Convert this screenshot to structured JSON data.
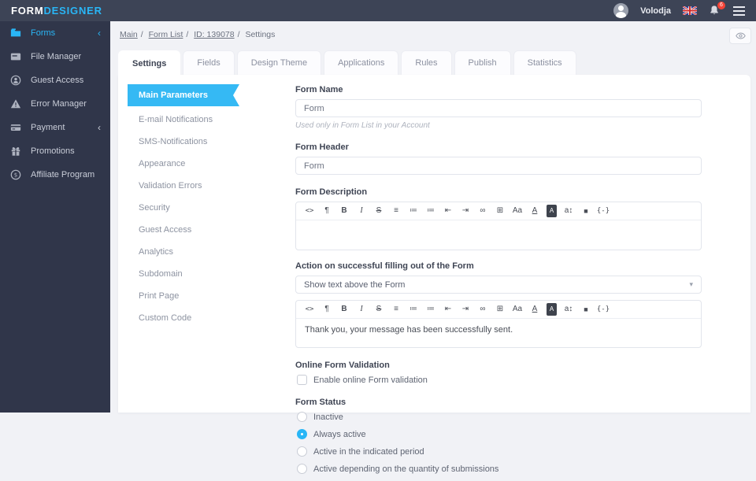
{
  "colors": {
    "accent": "#29b6f6",
    "header_bg": "#3d4456",
    "sidebar_bg": "#30364a",
    "page_bg": "#f1f2f6",
    "badge_red": "#f44336",
    "active_subnav": "#35b9f4"
  },
  "header": {
    "logo_primary": "FORM",
    "logo_accent": "DESIGNER",
    "username": "Volodja",
    "notification_count": "6"
  },
  "sidebar": {
    "chevron": "‹",
    "items": [
      {
        "label": "Forms",
        "icon": "forms-icon"
      },
      {
        "label": "File Manager",
        "icon": "file-manager-icon"
      },
      {
        "label": "Guest Access",
        "icon": "guest-access-icon"
      },
      {
        "label": "Error Manager",
        "icon": "error-manager-icon"
      },
      {
        "label": "Payment",
        "icon": "payment-icon"
      },
      {
        "label": "Promotions",
        "icon": "promotions-icon"
      },
      {
        "label": "Affiliate Program",
        "icon": "affiliate-icon"
      }
    ]
  },
  "breadcrumb": {
    "separator": "/",
    "items": [
      {
        "label": "Main"
      },
      {
        "label": "Form List"
      },
      {
        "label": "ID: 139078"
      },
      {
        "label": "Settings"
      }
    ]
  },
  "tabs": {
    "active": "Settings",
    "items": [
      {
        "label": "Settings"
      },
      {
        "label": "Fields"
      },
      {
        "label": "Design Theme"
      },
      {
        "label": "Applications"
      },
      {
        "label": "Rules"
      },
      {
        "label": "Publish"
      },
      {
        "label": "Statistics"
      }
    ]
  },
  "subnav": {
    "active": "Main Parameters",
    "items": [
      {
        "label": "Main Parameters"
      },
      {
        "label": "E-mail Notifications"
      },
      {
        "label": "SMS-Notifications"
      },
      {
        "label": "Appearance"
      },
      {
        "label": "Validation Errors"
      },
      {
        "label": "Security"
      },
      {
        "label": "Guest Access"
      },
      {
        "label": "Analytics"
      },
      {
        "label": "Subdomain"
      },
      {
        "label": "Print Page"
      },
      {
        "label": "Custom Code"
      }
    ]
  },
  "form": {
    "form_name": {
      "label": "Form Name",
      "value": "Form",
      "helper": "Used only in Form List in your Account"
    },
    "form_header": {
      "label": "Form Header",
      "value": "Form"
    },
    "form_description": {
      "label": "Form Description",
      "value": ""
    },
    "action": {
      "label": "Action on successful filling out of the Form",
      "selected": "Show text above the Form"
    },
    "success_message": "Thank you, your message has been successfully sent.",
    "validation": {
      "label": "Online Form Validation",
      "checkbox_label": "Enable online Form validation",
      "checked": false
    },
    "status": {
      "label": "Form Status",
      "selected": "Always active",
      "options": [
        {
          "label": "Inactive",
          "selected": false
        },
        {
          "label": "Always active",
          "selected": true
        },
        {
          "label": "Active in the indicated period",
          "selected": false
        },
        {
          "label": "Active depending on the quantity of submissions",
          "selected": false
        }
      ]
    }
  },
  "editor_toolbar": {
    "icons": [
      {
        "name": "code-view-icon",
        "glyph": "<>"
      },
      {
        "name": "paragraph-icon",
        "glyph": "¶"
      },
      {
        "name": "bold-icon",
        "glyph": "B"
      },
      {
        "name": "italic-icon",
        "glyph": "I"
      },
      {
        "name": "strikethrough-icon",
        "glyph": "S"
      },
      {
        "name": "align-left-icon",
        "glyph": "≡"
      },
      {
        "name": "unordered-list-icon",
        "glyph": "≔"
      },
      {
        "name": "ordered-list-icon",
        "glyph": "≔"
      },
      {
        "name": "outdent-icon",
        "glyph": "⇤"
      },
      {
        "name": "indent-icon",
        "glyph": "⇥"
      },
      {
        "name": "link-icon",
        "glyph": "∞"
      },
      {
        "name": "table-icon",
        "glyph": "⊞"
      },
      {
        "name": "font-size-icon",
        "glyph": "Aa"
      },
      {
        "name": "text-color-icon",
        "glyph": "A"
      },
      {
        "name": "background-color-icon",
        "glyph": "A"
      },
      {
        "name": "line-height-icon",
        "glyph": "a↕"
      },
      {
        "name": "image-icon",
        "glyph": "■"
      },
      {
        "name": "variables-icon",
        "glyph": "{-}"
      }
    ]
  },
  "icons": {
    "caret_down": "▾"
  }
}
